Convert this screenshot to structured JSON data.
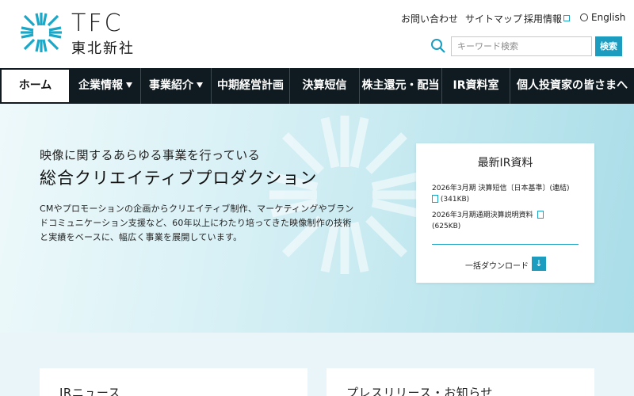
{
  "brand": {
    "name_en": "TFC",
    "name_jp": "東北新社"
  },
  "utility_nav": {
    "contact": "お問い合わせ",
    "sitemap": "サイトマップ",
    "careers": "採用情報",
    "language": "English"
  },
  "search": {
    "placeholder": "キーワード検索",
    "button_label": "検索"
  },
  "main_nav": [
    {
      "label": "ホーム",
      "active": true
    },
    {
      "label": "企業情報",
      "dropdown": true
    },
    {
      "label": "事業紹介",
      "dropdown": true
    },
    {
      "label": "中期経営計画"
    },
    {
      "label": "決算短信"
    },
    {
      "label": "株主還元・配当"
    },
    {
      "label": "IR資料室"
    },
    {
      "label": "個人投資家の皆さまへ"
    }
  ],
  "hero": {
    "tagline": "映像に関するあらゆる事業を行っている",
    "title": "総合クリエイティブプロダクション",
    "description_lines": [
      "CMやプロモーションの企画からクリエイティブ制作、マーケティングやブラン",
      "ドコミュニケーション支援など、60年以上にわたり培ってきた映像制作の技術",
      "と実績をベースに、幅広く事業を展開しています。"
    ]
  },
  "ir_card": {
    "title": "最新IR資料",
    "documents": [
      {
        "title": "2026年3月期 決算短信〔日本基準〕(連結)",
        "size": "(341KB)"
      },
      {
        "title": "2026年3月期通期決算説明資料",
        "size": "(625KB)"
      }
    ],
    "download_label": "一括ダウンロード"
  },
  "sections": {
    "ir_news": "IRニュース",
    "press": "プレスリリース・お知らせ"
  },
  "colors": {
    "accent": "#1c9cbf",
    "nav_bg": "#0f1b20",
    "hero_light": "#eef9fb",
    "hero_dark": "#a9dde8"
  },
  "icons": {
    "logo": "tfc-starburst-logo",
    "search": "search-icon",
    "external": "external-link-icon",
    "globe": "globe-icon",
    "pdf": "pdf-icon",
    "download": "download-icon"
  }
}
